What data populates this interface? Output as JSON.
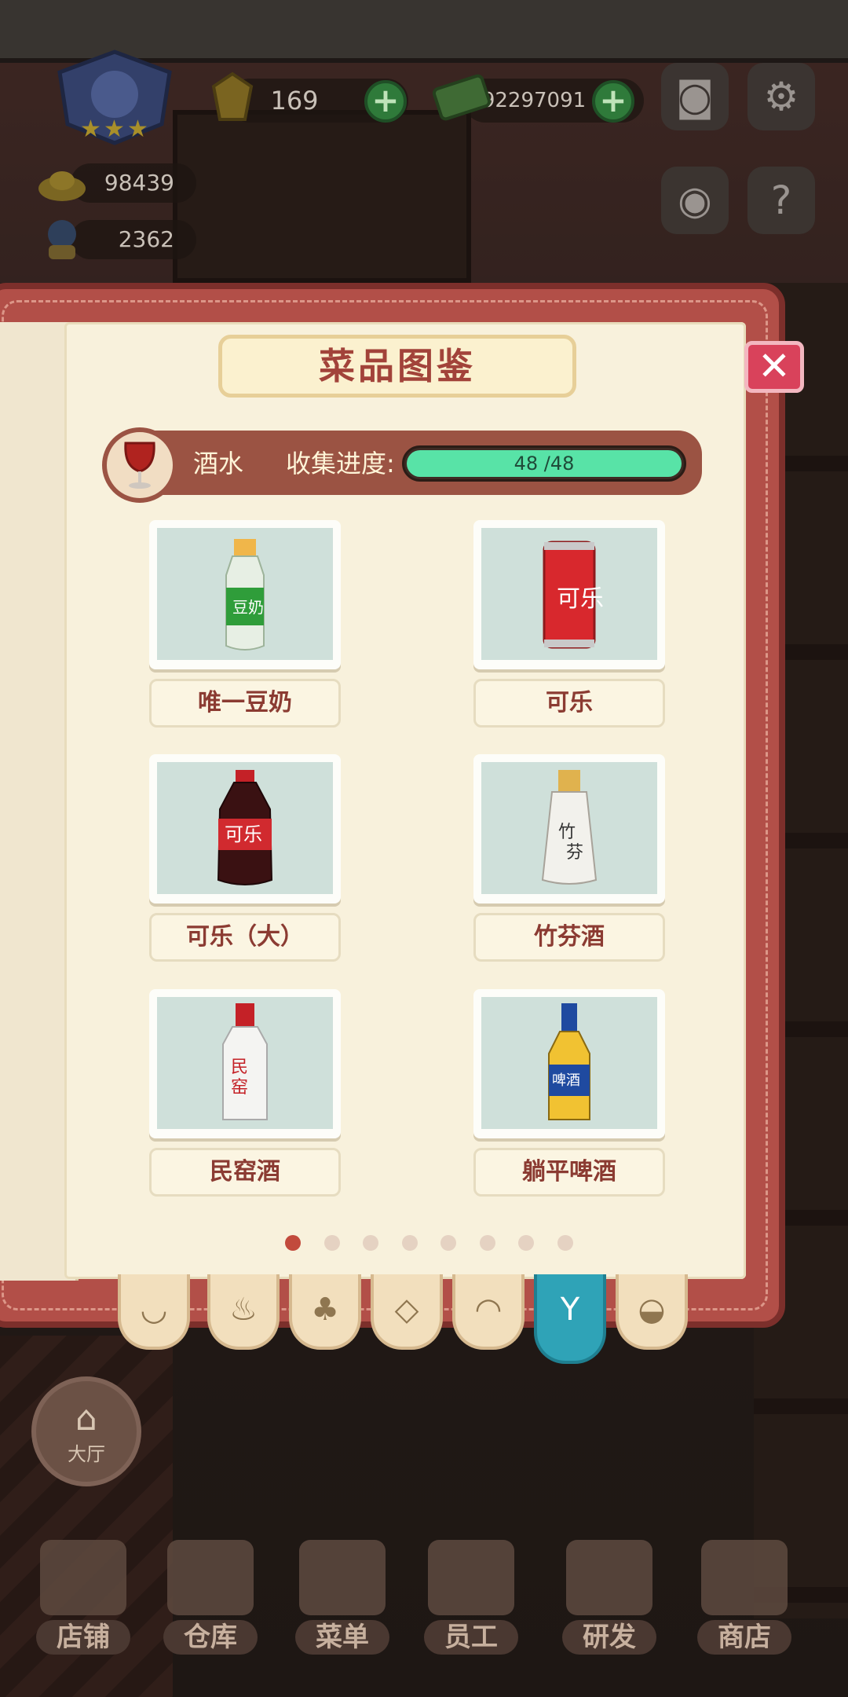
{
  "hud": {
    "gems": "169",
    "cash": "92297091",
    "gold": "98439",
    "staff": "2362",
    "plus": "+",
    "icons": [
      "star-badge-icon",
      "camera-icon",
      "gear-icon",
      "eye-icon",
      "help-book-icon"
    ]
  },
  "modal": {
    "title": "菜品图鉴",
    "close": "✕",
    "category": "酒水",
    "progress_label": "收集进度:",
    "progress_current": 48,
    "progress_total": 48,
    "progress_text": "48 /48",
    "progress_fraction": 1.0
  },
  "items": [
    {
      "name": "唯一豆奶",
      "icon": "soy-milk-bottle-icon"
    },
    {
      "name": "可乐",
      "icon": "cola-can-icon"
    },
    {
      "name": "可乐（大）",
      "icon": "cola-bottle-icon"
    },
    {
      "name": "竹芬酒",
      "icon": "liquor-bottle-icon"
    },
    {
      "name": "民窑酒",
      "icon": "baijiu-bottle-icon"
    },
    {
      "name": "躺平啤酒",
      "icon": "beer-bottle-icon"
    }
  ],
  "pagination": {
    "total": 8,
    "active": 0
  },
  "category_tabs": [
    {
      "icon": "wok-icon",
      "active": false
    },
    {
      "icon": "drumstick-icon",
      "active": false
    },
    {
      "icon": "broccoli-icon",
      "active": false
    },
    {
      "icon": "fish-icon",
      "active": false
    },
    {
      "icon": "bread-icon",
      "active": false
    },
    {
      "icon": "wine-glass-icon",
      "active": true
    },
    {
      "icon": "soup-bowl-icon",
      "active": false
    }
  ],
  "bottom_nav": {
    "hall": "大厅",
    "items": [
      "店铺",
      "仓库",
      "菜单",
      "员工",
      "研发",
      "商店"
    ]
  },
  "colors": {
    "accent": "#b24f48",
    "progress": "#58e3a7",
    "active_tab": "#2fa3b7",
    "item_text": "#8b3b32"
  }
}
